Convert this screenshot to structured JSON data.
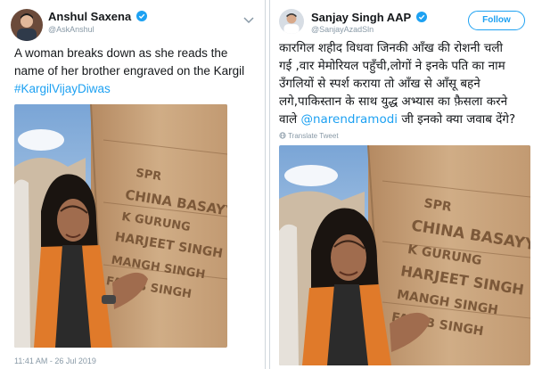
{
  "tweets": [
    {
      "author_name": "Anshul Saxena",
      "handle": "@AskAnshul",
      "text_plain": "A woman breaks down as she reads the name of her brother engraved on the Kargil",
      "hashtag": "#KargilVijayDiwas",
      "timestamp": "11:41 AM - 26 Jul 2019",
      "verified": true,
      "icons": [
        "avatar",
        "verified-badge-icon",
        "chevron-down-icon"
      ]
    },
    {
      "author_name": "Sanjay Singh AAP",
      "handle": "@SanjayAzadSln",
      "follow_label": "Follow",
      "hindi_line1": "कारगिल शहीद विधवा जिनकी आँख की रोशनी चली",
      "hindi_line2": "गई ,वार मेमोरियल पहुँची,लोगों ने इनके पति का नाम",
      "hindi_line3": "उँगलियों से स्पर्श कराया तो आँख से आँसू बहने",
      "hindi_line4": "लगे,पाकिस्तान के साथ युद्ध अभ्यास का फ़ैसला करने",
      "hindi_line5_prefix": "वाले",
      "mention": "@narendramodi",
      "hindi_line5_suffix": "जी इनको क्या जवाब देंगे?",
      "translate_label": "Translate Tweet",
      "verified": true,
      "icons": [
        "avatar",
        "verified-badge-icon",
        "globe-icon"
      ]
    }
  ],
  "memorial_inscription": [
    "SPR",
    "CHINA BASAYYA",
    "K GURUNG",
    "HARJEET SINGH",
    "MANGH SINGH",
    "FALAB SINGH"
  ],
  "colors": {
    "link": "#1da1f2",
    "text": "#14171a",
    "muted": "#8899a6",
    "stone": "#c9a57e",
    "sky": "#8fb3d9"
  }
}
